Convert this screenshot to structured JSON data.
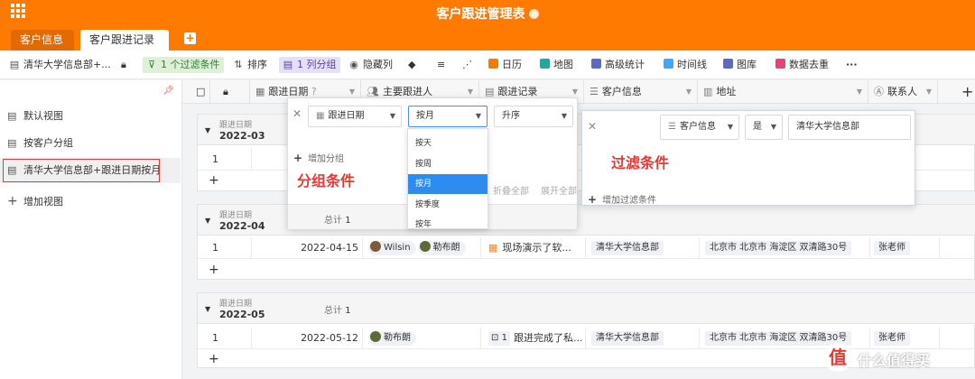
{
  "app": {
    "title": "客户跟进管理表"
  },
  "tabs": [
    {
      "label": "客户信息"
    },
    {
      "label": "客户跟进记录"
    }
  ],
  "toolbar": {
    "view_name": "清华大学信息部+...",
    "filter": "1 个过滤条件",
    "sort": "排序",
    "group": "1 列分组",
    "hide_cols": "隐藏列",
    "calendar": "日历",
    "map": "地图",
    "advanced_stats": "高级统计",
    "timeline": "时间线",
    "gallery": "图库",
    "dedupe": "数据去重",
    "more": "···"
  },
  "sidebar": {
    "items": [
      {
        "label": "默认视图"
      },
      {
        "label": "按客户分组"
      },
      {
        "label": "清华大学信息部+跟进日期按月"
      }
    ],
    "add_view": "增加视图"
  },
  "columns": {
    "date": "跟进日期",
    "owner": "主要跟进人",
    "record": "跟进记录",
    "customer": "客户信息",
    "address": "地址",
    "contact": "联系人"
  },
  "groups": [
    {
      "label": "跟进日期",
      "value": "2022-03",
      "rows": [
        {
          "num": "1"
        }
      ]
    },
    {
      "label": "跟进日期",
      "value": "2022-04",
      "rows": [
        {
          "num": "1",
          "date": "2022-04-15",
          "owner1": "Wilsin",
          "owner2": "勒布朗",
          "record": "现场演示了软...",
          "customer": "清华大学信息部",
          "address": "北京市 北京市 海淀区 双清路30号",
          "contact": "张老师"
        }
      ]
    },
    {
      "label": "跟进日期",
      "value": "2022-05",
      "total_label": "总计",
      "total_value": "1",
      "rows": [
        {
          "num": "1",
          "date": "2022-05-12",
          "owner1": "勒布朗",
          "record_count": "1",
          "record": "跟进完成了私...",
          "customer": "清华大学信息部",
          "address": "北京市 北京市 海淀区 双清路30号",
          "contact": "张老师"
        }
      ]
    }
  ],
  "group_popup": {
    "field": "跟进日期",
    "granularity": "按月",
    "order": "升序",
    "add_group": "增加分组",
    "note": "分组条件",
    "collapse_all": "折叠全部",
    "expand_all": "展开全部",
    "total_label": "总计",
    "total_value": "1",
    "options": [
      "按天",
      "按周",
      "按月",
      "按季度",
      "按年"
    ]
  },
  "filter_popup": {
    "field": "客户信息",
    "operator": "是",
    "value": "清华大学信息部",
    "note": "过滤条件",
    "add_filter": "增加过滤条件"
  },
  "watermark": {
    "text": "什么值得买",
    "logo_char": "值"
  },
  "colors": {
    "brand": "#ff7a00",
    "accent": "#2d8cf0",
    "annotation": "#e53935"
  }
}
